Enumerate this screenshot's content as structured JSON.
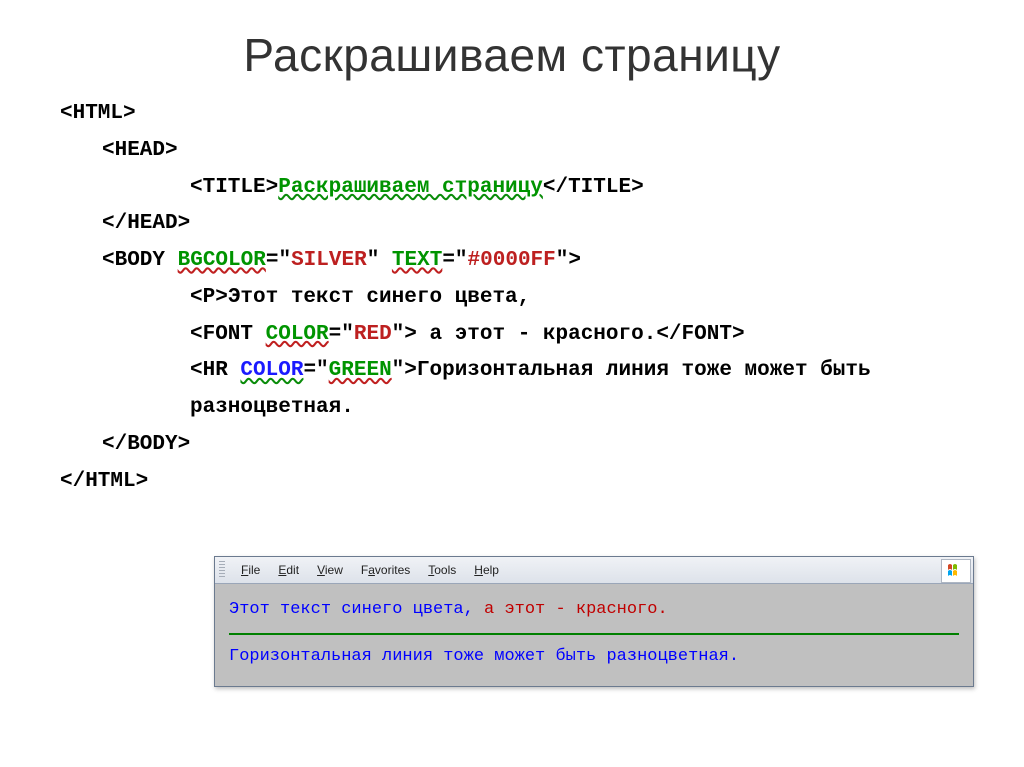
{
  "title": "Раскрашиваем страницу",
  "code": {
    "html_open": "<HTML>",
    "head_open": "<HEAD>",
    "title_open": "<TITLE>",
    "title_text": "Раскрашиваем страницу",
    "title_close": "</TITLE>",
    "head_close": "</HEAD>",
    "body_open_1": "<BODY ",
    "body_attr1_name": "BGCOLOR",
    "eq": "=\"",
    "body_attr1_val": "SILVER",
    "mid1": "\" ",
    "body_attr2_name": "TEXT",
    "body_attr2_val": "#0000FF",
    "endq": "\">",
    "p_open": "<P>",
    "p_text": "Этот текст синего цвета,",
    "font_open1": "<FONT ",
    "font_attr_name": "COLOR",
    "font_attr_val": "RED",
    "font_open2": "\"> ",
    "font_text": "а этот - красного.",
    "font_close": "</FONT>",
    "hr_open1": "<HR ",
    "hr_attr_name": "COLOR",
    "hr_attr_val": "GREEN",
    "hr_open2": "\">",
    "hr_tail": "Горизонтальная линия тоже может быть разноцветная.",
    "body_close": "</BODY>",
    "html_close": "</HTML>"
  },
  "browser": {
    "menu": [
      "File",
      "Edit",
      "View",
      "Favorites",
      "Tools",
      "Help"
    ],
    "line1_blue": "Этот текст синего цвета, ",
    "line1_red": "а этот - красного.",
    "line2": "Горизонтальная линия тоже может быть разноцветная."
  }
}
